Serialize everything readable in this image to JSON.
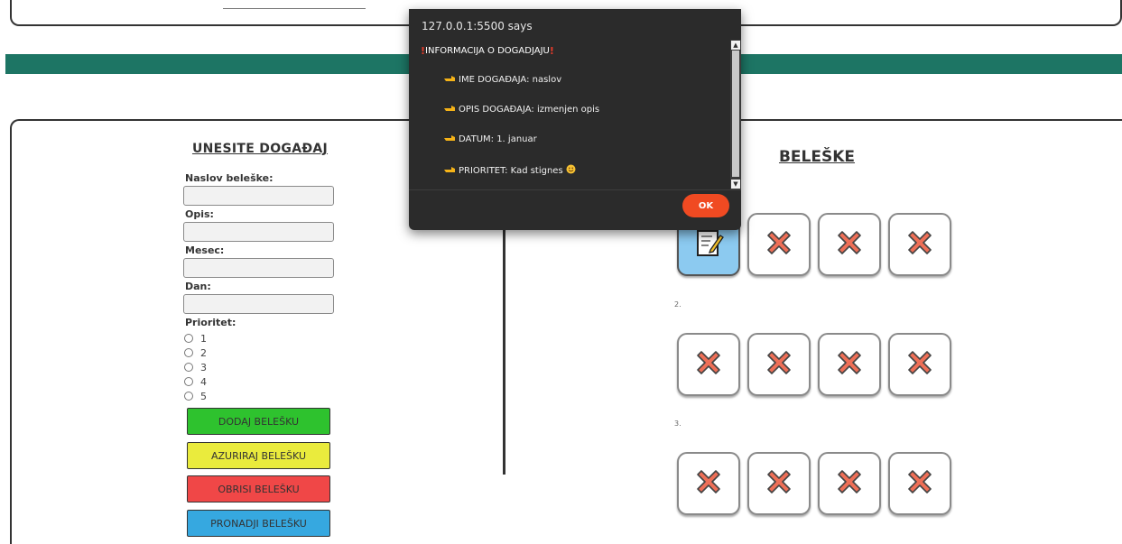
{
  "form": {
    "title": "UNESITE DOGAĐAJ",
    "fields": [
      {
        "label": "Naslov beleške:",
        "value": ""
      },
      {
        "label": "Opis:",
        "value": ""
      },
      {
        "label": "Mesec:",
        "value": ""
      },
      {
        "label": "Dan:",
        "value": ""
      }
    ],
    "priority_label": "Prioritet:",
    "priority_options": [
      "1",
      "2",
      "3",
      "4",
      "5"
    ],
    "buttons": {
      "add": "DODAJ BELEŠKU",
      "update": "AZURIRAJ BELEŠKU",
      "delete": "OBRISI BELEŠKU",
      "find": "PRONADJI BELEŠKU"
    }
  },
  "notes": {
    "title": "BELEŠKE",
    "row_labels": [
      "2.",
      "3."
    ],
    "rows": [
      [
        "note-icon",
        "x-icon",
        "x-icon",
        "x-icon"
      ],
      [
        "x-icon",
        "x-icon",
        "x-icon",
        "x-icon"
      ],
      [
        "x-icon",
        "x-icon",
        "x-icon",
        "x-icon"
      ]
    ],
    "active_tile": "1-1"
  },
  "dialog": {
    "origin": "127.0.0.1:5500 says",
    "header": "INFORMACIJA O DOGADJAJU",
    "lines": [
      "IME DOGAĐAJA: naslov",
      "OPIS DOGAĐAJA: izmenjen opis",
      "DATUM: 1. januar",
      "PRIORITET: Kad stignes"
    ],
    "ok_label": "OK",
    "colors": {
      "ok": "#f04a22",
      "exclamation": "#e53b2a",
      "background": "#2b2b2b"
    }
  },
  "colors": {
    "teal_band": "#1d7564",
    "btn_add": "#2ec22e",
    "btn_update": "#eaeb3d",
    "btn_delete": "#f04747",
    "btn_find": "#36a8e0",
    "active_tile": "#8ccaf0",
    "x_mark": "#ee6f57"
  }
}
